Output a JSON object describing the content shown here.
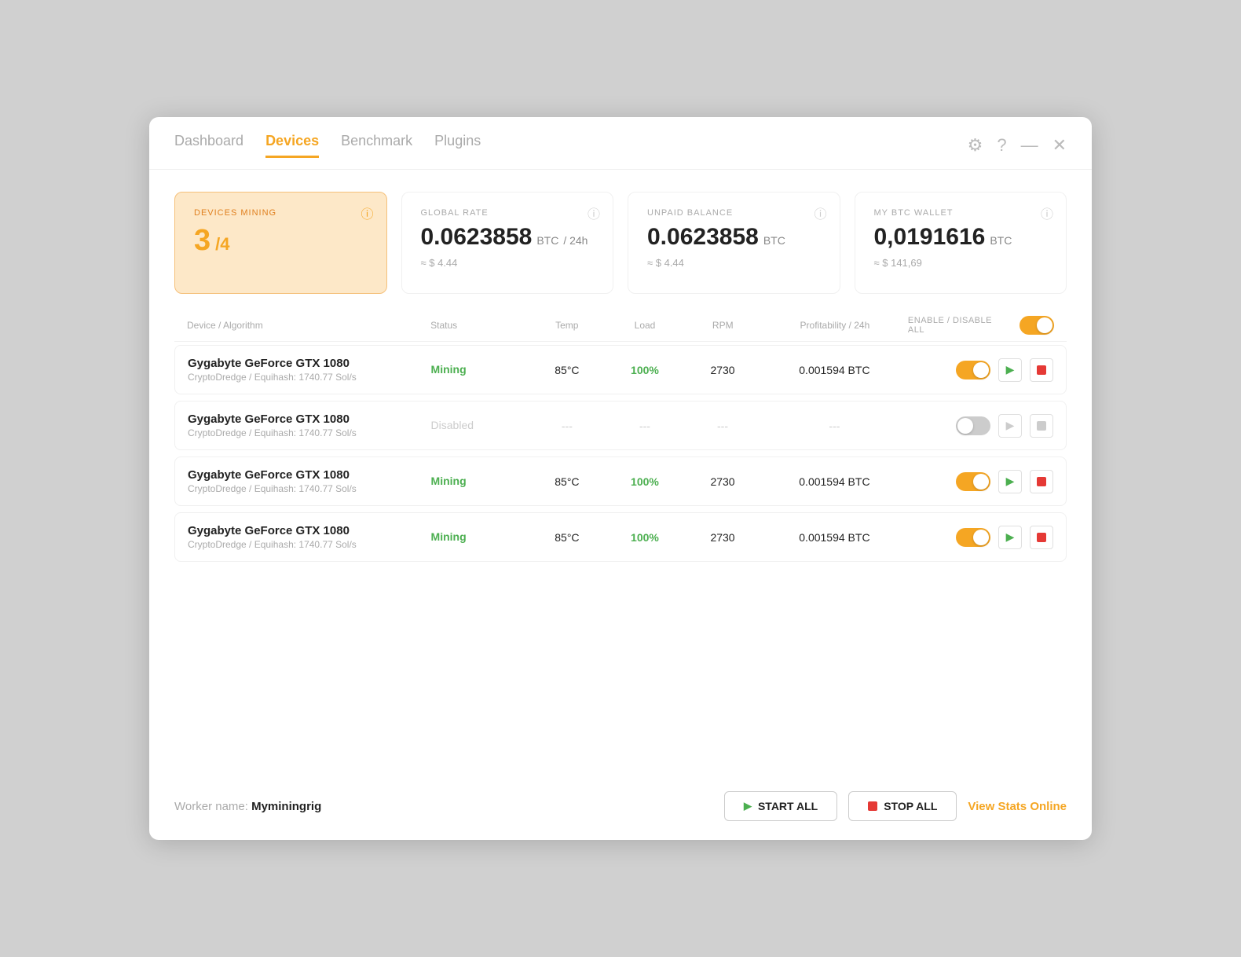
{
  "nav": {
    "tabs": [
      {
        "label": "Dashboard",
        "active": false
      },
      {
        "label": "Devices",
        "active": true
      },
      {
        "label": "Benchmark",
        "active": false
      },
      {
        "label": "Plugins",
        "active": false
      }
    ]
  },
  "stats": {
    "devices_mining": {
      "label": "DEVICES MINING",
      "count": "3",
      "total": "/4"
    },
    "global_rate": {
      "label": "GLOBAL RATE",
      "value": "0.0623858",
      "unit": "BTC",
      "per": "/ 24h",
      "approx": "≈ $ 4.44"
    },
    "unpaid_balance": {
      "label": "UNPAID BALANCE",
      "value": "0.0623858",
      "unit": "BTC",
      "approx": "≈ $ 4.44"
    },
    "btc_wallet": {
      "label": "MY BTC WALLET",
      "value": "0,0191616",
      "unit": "BTC",
      "approx": "≈ $ 141,69"
    }
  },
  "table": {
    "headers": {
      "device": "Device / Algorithm",
      "status": "Status",
      "temp": "Temp",
      "load": "Load",
      "rpm": "RPM",
      "profit": "Profitability / 24h",
      "enable_disable": "ENABLE / DISABLE ALL"
    },
    "rows": [
      {
        "name": "Gygabyte GeForce GTX 1080",
        "algo": "CryptoDredge / Equihash: 1740.77 Sol/s",
        "status": "Mining",
        "status_type": "mining",
        "temp": "85°C",
        "load": "100%",
        "rpm": "2730",
        "profit": "0.001594 BTC",
        "enabled": true
      },
      {
        "name": "Gygabyte GeForce GTX 1080",
        "algo": "CryptoDredge / Equihash: 1740.77 Sol/s",
        "status": "Disabled",
        "status_type": "disabled",
        "temp": "---",
        "load": "---",
        "rpm": "---",
        "profit": "---",
        "enabled": false
      },
      {
        "name": "Gygabyte GeForce GTX 1080",
        "algo": "CryptoDredge / Equihash: 1740.77 Sol/s",
        "status": "Mining",
        "status_type": "mining",
        "temp": "85°C",
        "load": "100%",
        "rpm": "2730",
        "profit": "0.001594 BTC",
        "enabled": true
      },
      {
        "name": "Gygabyte GeForce GTX 1080",
        "algo": "CryptoDredge / Equihash: 1740.77 Sol/s",
        "status": "Mining",
        "status_type": "mining",
        "temp": "85°C",
        "load": "100%",
        "rpm": "2730",
        "profit": "0.001594 BTC",
        "enabled": true
      }
    ]
  },
  "footer": {
    "worker_label": "Worker name:",
    "worker_name": "Myminingrig",
    "start_all": "START ALL",
    "stop_all": "STOP ALL",
    "view_stats": "View Stats Online"
  }
}
